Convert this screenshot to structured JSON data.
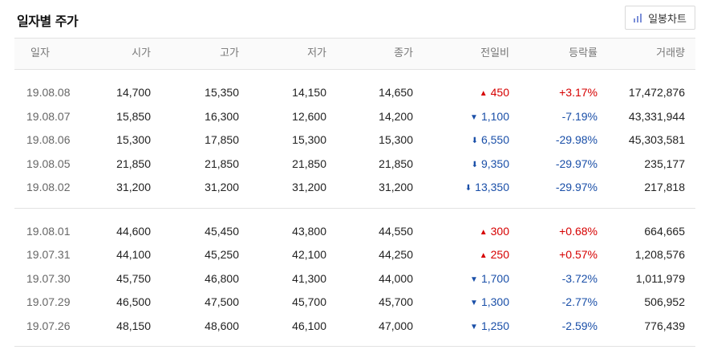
{
  "header": {
    "title": "일자별 주가",
    "chart_button_label": "일봉차트"
  },
  "columns": [
    "일자",
    "시가",
    "고가",
    "저가",
    "종가",
    "전일비",
    "등락률",
    "거래량"
  ],
  "groups": [
    {
      "rows": [
        {
          "date": "19.08.08",
          "open": "14,700",
          "high": "15,350",
          "low": "14,150",
          "close": "14,650",
          "dir": "up",
          "arrow": "▲",
          "change": "450",
          "rate": "+3.17%",
          "volume": "17,472,876"
        },
        {
          "date": "19.08.07",
          "open": "15,850",
          "high": "16,300",
          "low": "12,600",
          "close": "14,200",
          "dir": "down",
          "arrow": "▼",
          "change": "1,100",
          "rate": "-7.19%",
          "volume": "43,331,944"
        },
        {
          "date": "19.08.06",
          "open": "15,300",
          "high": "17,850",
          "low": "15,300",
          "close": "15,300",
          "dir": "down",
          "arrow": "⬇",
          "change": "6,550",
          "rate": "-29.98%",
          "volume": "45,303,581"
        },
        {
          "date": "19.08.05",
          "open": "21,850",
          "high": "21,850",
          "low": "21,850",
          "close": "21,850",
          "dir": "down",
          "arrow": "⬇",
          "change": "9,350",
          "rate": "-29.97%",
          "volume": "235,177"
        },
        {
          "date": "19.08.02",
          "open": "31,200",
          "high": "31,200",
          "low": "31,200",
          "close": "31,200",
          "dir": "down",
          "arrow": "⬇",
          "change": "13,350",
          "rate": "-29.97%",
          "volume": "217,818"
        }
      ]
    },
    {
      "rows": [
        {
          "date": "19.08.01",
          "open": "44,600",
          "high": "45,450",
          "low": "43,800",
          "close": "44,550",
          "dir": "up",
          "arrow": "▲",
          "change": "300",
          "rate": "+0.68%",
          "volume": "664,665"
        },
        {
          "date": "19.07.31",
          "open": "44,100",
          "high": "45,250",
          "low": "42,100",
          "close": "44,250",
          "dir": "up",
          "arrow": "▲",
          "change": "250",
          "rate": "+0.57%",
          "volume": "1,208,576"
        },
        {
          "date": "19.07.30",
          "open": "45,750",
          "high": "46,800",
          "low": "41,300",
          "close": "44,000",
          "dir": "down",
          "arrow": "▼",
          "change": "1,700",
          "rate": "-3.72%",
          "volume": "1,011,979"
        },
        {
          "date": "19.07.29",
          "open": "46,500",
          "high": "47,500",
          "low": "45,700",
          "close": "45,700",
          "dir": "down",
          "arrow": "▼",
          "change": "1,300",
          "rate": "-2.77%",
          "volume": "506,952"
        },
        {
          "date": "19.07.26",
          "open": "48,150",
          "high": "48,600",
          "low": "46,100",
          "close": "47,000",
          "dir": "down",
          "arrow": "▼",
          "change": "1,250",
          "rate": "-2.59%",
          "volume": "776,439"
        }
      ]
    }
  ],
  "colors": {
    "up": "#d60000",
    "down": "#1a4fa8"
  }
}
